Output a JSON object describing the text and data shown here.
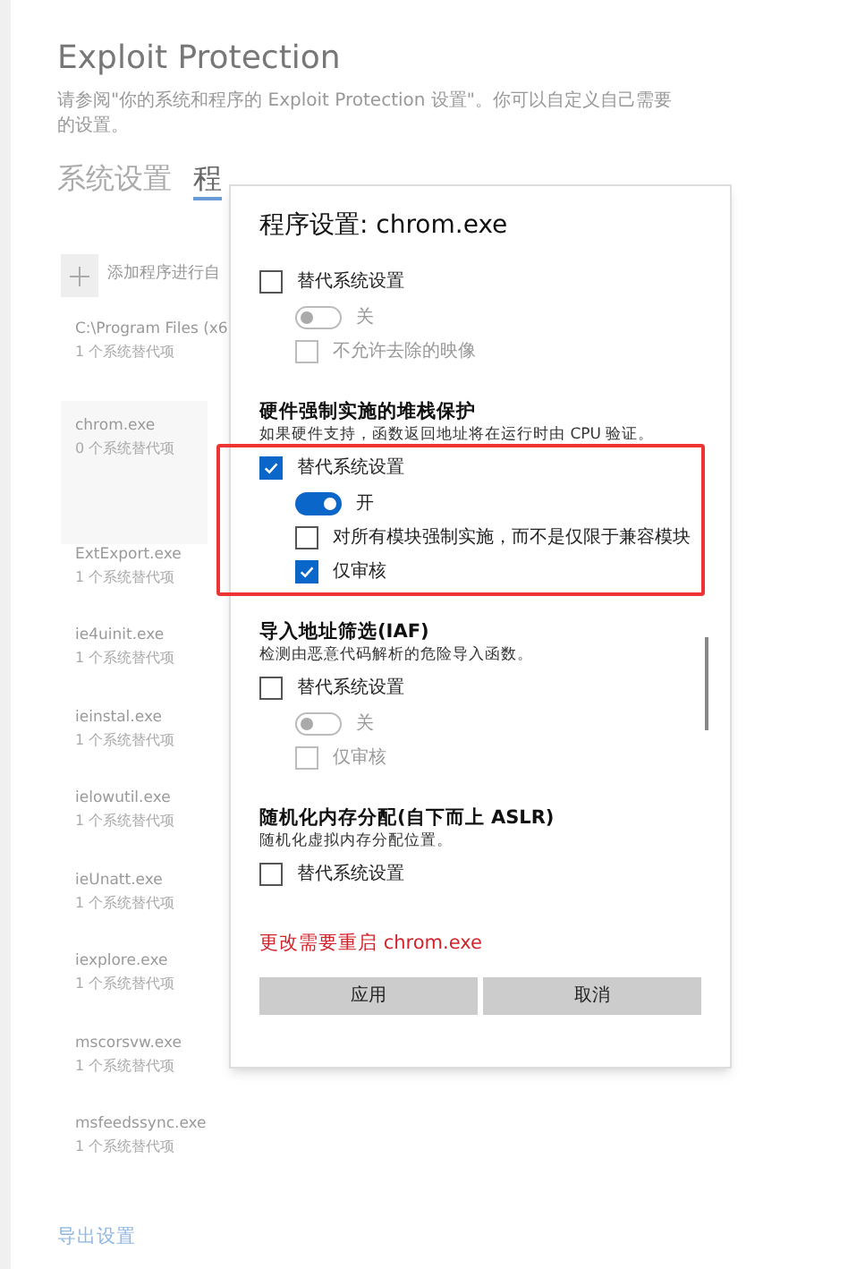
{
  "page": {
    "title": "Exploit Protection",
    "description": "请参阅\"你的系统和程序的 Exploit Protection 设置\"。你可以自定义自己需要的设置。",
    "tabs": [
      {
        "label": "系统设置",
        "selected": false
      },
      {
        "label": "程",
        "selected": true
      }
    ],
    "add_program": "添加程序进行自",
    "programs": [
      {
        "name": "C:\\Program Files (x6",
        "overrides": "1 个系统替代项",
        "selected": false
      },
      {
        "name": "chrom.exe",
        "overrides": "0 个系统替代项",
        "selected": true
      },
      {
        "name": "ExtExport.exe",
        "overrides": "1 个系统替代项",
        "selected": false
      },
      {
        "name": "ie4uinit.exe",
        "overrides": "1 个系统替代项",
        "selected": false
      },
      {
        "name": "ieinstal.exe",
        "overrides": "1 个系统替代项",
        "selected": false
      },
      {
        "name": "ielowutil.exe",
        "overrides": "1 个系统替代项",
        "selected": false
      },
      {
        "name": "ieUnatt.exe",
        "overrides": "1 个系统替代项",
        "selected": false
      },
      {
        "name": "iexplore.exe",
        "overrides": "1 个系统替代项",
        "selected": false
      },
      {
        "name": "mscorsvw.exe",
        "overrides": "1 个系统替代项",
        "selected": false
      },
      {
        "name": "msfeedssync.exe",
        "overrides": "1 个系统替代项",
        "selected": false
      }
    ],
    "export_link": "导出设置"
  },
  "dialog": {
    "title": "程序设置: chrom.exe",
    "sections": [
      {
        "items": [
          {
            "kind": "checkbox",
            "label": "替代系统设置",
            "checked": false,
            "disabled": false
          },
          {
            "kind": "toggle",
            "label": "关",
            "on": false,
            "disabled": true
          },
          {
            "kind": "checkbox",
            "label": "不允许去除的映像",
            "checked": false,
            "disabled": true
          }
        ]
      },
      {
        "heading": "硬件强制实施的堆栈保护",
        "description": "如果硬件支持，函数返回地址将在运行时由 CPU 验证。",
        "highlighted": true,
        "items": [
          {
            "kind": "checkbox",
            "label": "替代系统设置",
            "checked": true,
            "disabled": false
          },
          {
            "kind": "toggle",
            "label": "开",
            "on": true,
            "disabled": false
          },
          {
            "kind": "checkbox",
            "label": "对所有模块强制实施，而不是仅限于兼容模块",
            "checked": false,
            "disabled": false
          },
          {
            "kind": "checkbox",
            "label": "仅审核",
            "checked": true,
            "disabled": false
          }
        ]
      },
      {
        "heading": "导入地址筛选(IAF)",
        "description": "检测由恶意代码解析的危险导入函数。",
        "items": [
          {
            "kind": "checkbox",
            "label": "替代系统设置",
            "checked": false,
            "disabled": false
          },
          {
            "kind": "toggle",
            "label": "关",
            "on": false,
            "disabled": true
          },
          {
            "kind": "checkbox",
            "label": "仅审核",
            "checked": false,
            "disabled": true
          }
        ]
      },
      {
        "heading": "随机化内存分配(自下而上 ASLR)",
        "description": "随机化虚拟内存分配位置。",
        "items": [
          {
            "kind": "checkbox",
            "label": "替代系统设置",
            "checked": false,
            "disabled": false
          }
        ]
      }
    ],
    "warning": "更改需要重启 chrom.exe",
    "buttons": [
      "应用",
      "取消"
    ]
  }
}
